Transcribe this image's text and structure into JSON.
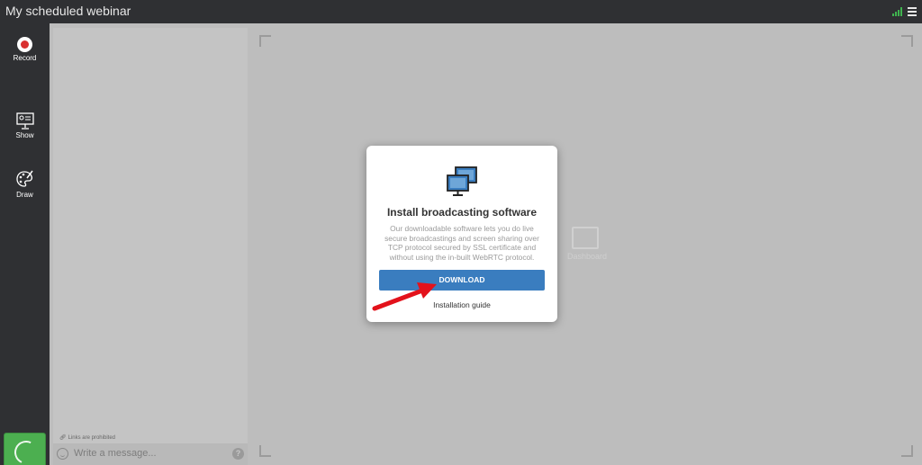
{
  "app": {
    "title": "My scheduled webinar"
  },
  "sidebar": {
    "record_label": "Record",
    "show_label": "Show",
    "draw_label": "Draw"
  },
  "chat": {
    "links_note": "Links are prohibited",
    "input_placeholder": "Write a message...",
    "help_glyph": "?"
  },
  "stage": {
    "placeholder_label": "Dashboard"
  },
  "modal": {
    "title": "Install broadcasting software",
    "description": "Our downloadable software lets you do live secure broadcastings and screen sharing over TCP protocol secured by SSL certificate and without using the in-built WebRTC protocol.",
    "download_label": "DOWNLOAD",
    "guide_label": "Installation guide"
  },
  "colors": {
    "topbar_bg": "#2f3033",
    "accent_blue": "#3a7dbf",
    "live_green": "#4caf50",
    "record_red": "#d92f2f",
    "annotation_arrow": "#e3121b"
  },
  "icons": [
    "signal-bars-icon",
    "hamburger-menu-icon",
    "record-icon",
    "presentation-board-icon",
    "palette-brush-icon",
    "loading-spinner-icon",
    "link-icon",
    "emoji-icon",
    "help-icon",
    "image-placeholder-icon",
    "monitors-icon",
    "red-arrow-annotation"
  ]
}
